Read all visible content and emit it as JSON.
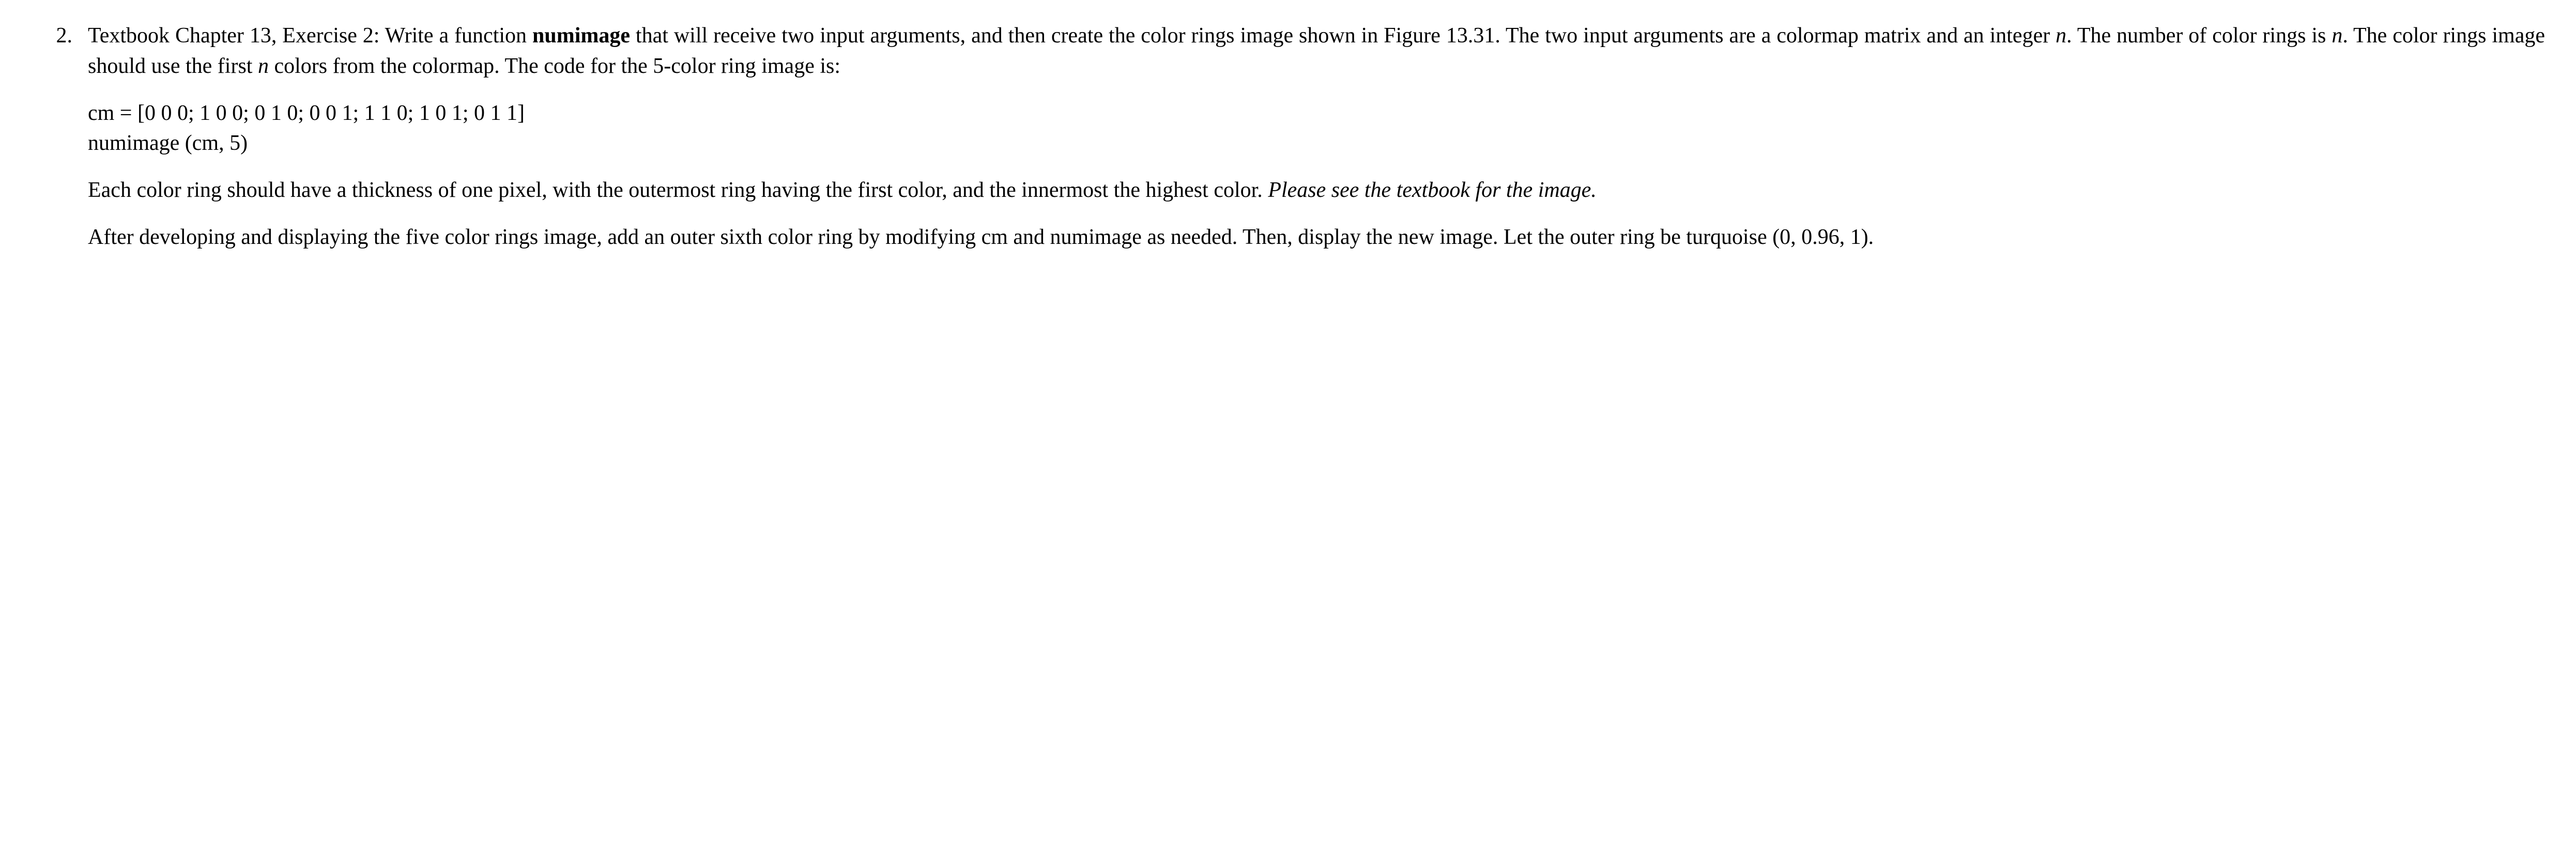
{
  "problem": {
    "number": "2.",
    "para1_prefix": "Textbook Chapter 13, Exercise 2: Write a function ",
    "para1_bold": "numimage",
    "para1_suffix1": " that will receive two input arguments, and then create the color rings image shown in Figure 13.31.  The two input arguments are a colormap matrix and an integer ",
    "para1_italic1": "n",
    "para1_mid1": ". The number of color rings is ",
    "para1_italic2": "n",
    "para1_mid2": ".  The color rings image should use the first ",
    "para1_italic3": "n",
    "para1_suffix2": " colors from the colormap. The code for the 5-color ring image is:",
    "code_line1": "cm = [0  0  0; 1  0  0; 0  1  0; 0  0  1; 1  1  0; 1  0  1; 0  1  1]",
    "code_line2": "numimage (cm, 5)",
    "para2_prefix": "Each color ring should have a thickness of one pixel, with the outermost ring having the first color, and the innermost the highest color.  ",
    "para2_italic": "Please see the textbook for the image.",
    "para3": "After developing and displaying the five color rings image, add an outer sixth color ring by modifying cm and numimage as needed.  Then, display the new image.  Let the outer ring be turquoise (0, 0.96, 1)."
  }
}
